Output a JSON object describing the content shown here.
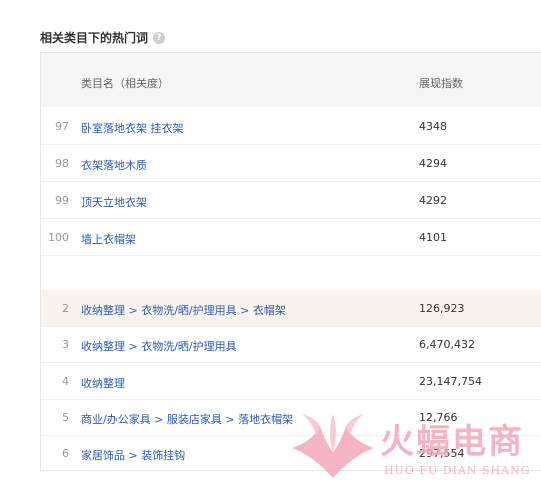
{
  "section": {
    "title": "相关类目下的热门词",
    "help_icon": "?"
  },
  "table": {
    "header": {
      "category": "类目名（相关度）",
      "value": "展现指数"
    },
    "keyword_rows": [
      {
        "rank": "97",
        "name": "卧室落地衣架 挂衣架",
        "value": "4348"
      },
      {
        "rank": "98",
        "name": "衣架落地木质",
        "value": "4294"
      },
      {
        "rank": "99",
        "name": "顶天立地衣架",
        "value": "4292"
      },
      {
        "rank": "100",
        "name": "墙上衣帽架",
        "value": "4101"
      }
    ],
    "category_rows": [
      {
        "rank": "2",
        "name": "收纳整理 > 衣物洗/晒/护理用具 > 衣帽架",
        "value": "126,923",
        "highlighted": true
      },
      {
        "rank": "3",
        "name": "收纳整理 > 衣物洗/晒/护理用具",
        "value": "6,470,432",
        "highlighted": false
      },
      {
        "rank": "4",
        "name": "收纳整理",
        "value": "23,147,754",
        "highlighted": false
      },
      {
        "rank": "5",
        "name": "商业/办公家具 > 服装店家具 > 落地衣帽架",
        "value": "12,766",
        "highlighted": false
      },
      {
        "rank": "6",
        "name": "家居饰品 > 装饰挂钩",
        "value": "297,554",
        "highlighted": false
      }
    ]
  },
  "watermark": {
    "brand": "火蝠电商",
    "subtitle": "HUO FU DIAN SHANG",
    "color": "#f4a7b8"
  },
  "colors": {
    "link": "#2a5db0",
    "highlight_row": "#fbf4ee",
    "header_bg": "#f6f6f6"
  }
}
